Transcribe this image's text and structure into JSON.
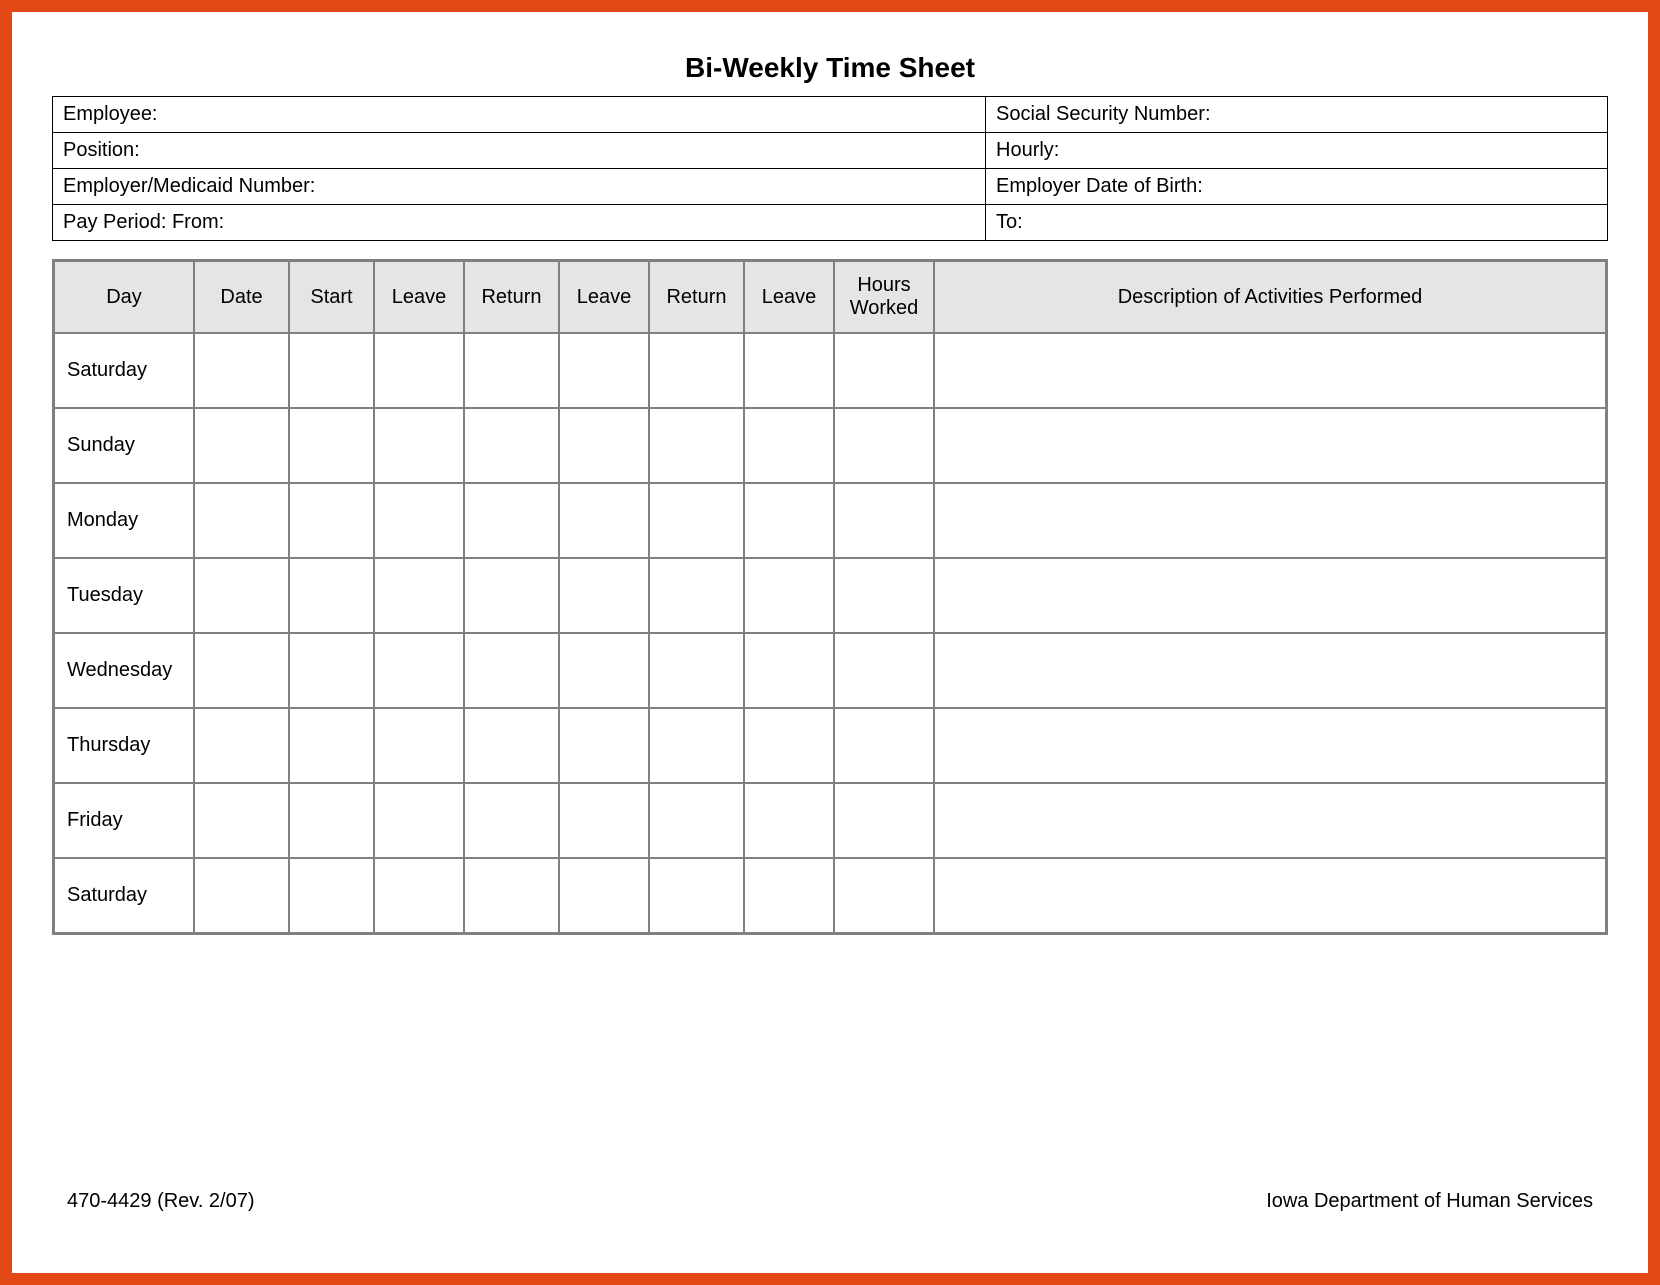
{
  "title": "Bi-Weekly Time Sheet",
  "info": {
    "employee_label": "Employee:",
    "ssn_label": "Social Security Number:",
    "position_label": "Position:",
    "hourly_label": "Hourly:",
    "employer_medicaid_label": "Employer/Medicaid Number:",
    "employer_dob_label": "Employer Date of Birth:",
    "pay_period_from_label": "Pay Period:  From:",
    "pay_period_to_label": "To:"
  },
  "columns": {
    "day": "Day",
    "date": "Date",
    "start": "Start",
    "leave1": "Leave",
    "return1": "Return",
    "leave2": "Leave",
    "return2": "Return",
    "leave3": "Leave",
    "hours_worked": "Hours Worked",
    "description": "Description of Activities Performed"
  },
  "rows": [
    {
      "day": "Saturday"
    },
    {
      "day": "Sunday"
    },
    {
      "day": "Monday"
    },
    {
      "day": "Tuesday"
    },
    {
      "day": "Wednesday"
    },
    {
      "day": "Thursday"
    },
    {
      "day": "Friday"
    },
    {
      "day": "Saturday"
    }
  ],
  "footer": {
    "form_code": "470-4429  (Rev. 2/07)",
    "department": "Iowa Department of Human Services"
  }
}
